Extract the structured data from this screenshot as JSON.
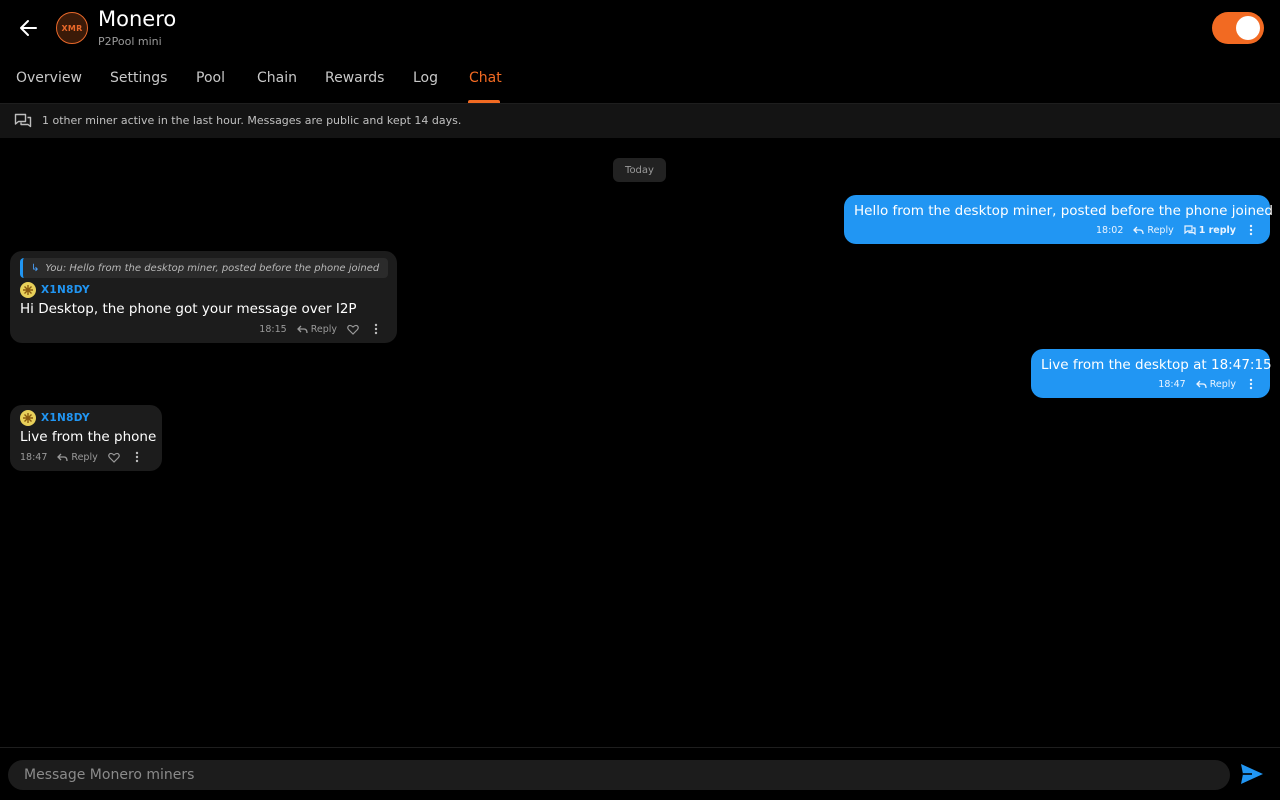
{
  "header": {
    "coin_symbol": "XMR",
    "title": "Monero",
    "subtitle": "P2Pool mini",
    "mining_enabled": true,
    "accent_color": "#f26a22"
  },
  "tabs": [
    {
      "label": "Overview",
      "active": false
    },
    {
      "label": "Settings",
      "active": false
    },
    {
      "label": "Pool",
      "active": false
    },
    {
      "label": "Chain",
      "active": false
    },
    {
      "label": "Rewards",
      "active": false
    },
    {
      "label": "Log",
      "active": false
    },
    {
      "label": "Chat",
      "active": true
    }
  ],
  "banner": {
    "icon": "chat-bubbles-icon",
    "text": "1 other miner active in the last hour. Messages are public and kept 14 days."
  },
  "date_separator": "Today",
  "messages": [
    {
      "direction": "outgoing",
      "text": "Hello from the desktop miner, posted before the phone joined",
      "time": "18:02",
      "reply_label": "Reply",
      "thread_label": "1 reply"
    },
    {
      "direction": "incoming",
      "quote": "You: Hello from the desktop miner, posted before the phone joined",
      "sender": "X1N8DY",
      "text": "Hi Desktop, the phone got your message over I2P",
      "time": "18:15",
      "reply_label": "Reply"
    },
    {
      "direction": "outgoing",
      "text": "Live from the desktop at 18:47:15",
      "time": "18:47",
      "reply_label": "Reply"
    },
    {
      "direction": "incoming",
      "sender": "X1N8DY",
      "text": "Live from the phone",
      "time": "18:47",
      "reply_label": "Reply"
    }
  ],
  "composer": {
    "placeholder": "Message Monero miners",
    "value": ""
  },
  "colors": {
    "outgoing_bubble": "#2196f3",
    "incoming_bubble": "#1c1c1c",
    "sender_name": "#2196f3"
  }
}
